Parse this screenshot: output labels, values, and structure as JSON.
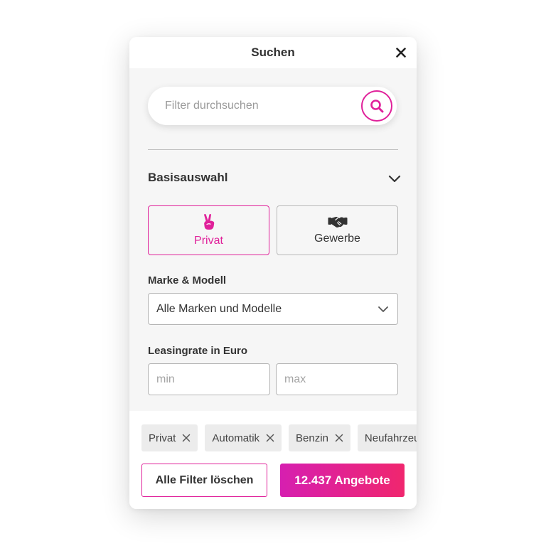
{
  "modal": {
    "title": "Suchen"
  },
  "search": {
    "placeholder": "Filter durchsuchen",
    "value": ""
  },
  "basisauswahl": {
    "title": "Basisauswahl",
    "types": [
      {
        "label": "Privat",
        "icon": "peace-hand-icon",
        "selected": true
      },
      {
        "label": "Gewerbe",
        "icon": "handshake-icon",
        "selected": false
      }
    ]
  },
  "brand": {
    "label": "Marke & Modell",
    "selected": "Alle Marken und Modelle"
  },
  "leasing": {
    "label": "Leasingrate in Euro",
    "min_placeholder": "min",
    "max_placeholder": "max"
  },
  "chips": [
    "Privat",
    "Automatik",
    "Benzin",
    "Neufahrzeug"
  ],
  "actions": {
    "clear_label": "Alle Filter löschen",
    "results_label": "12.437 Angebote"
  },
  "colors": {
    "accent": "#e0219a",
    "gradient_start": "#d61fb0",
    "gradient_end": "#f0266e"
  }
}
